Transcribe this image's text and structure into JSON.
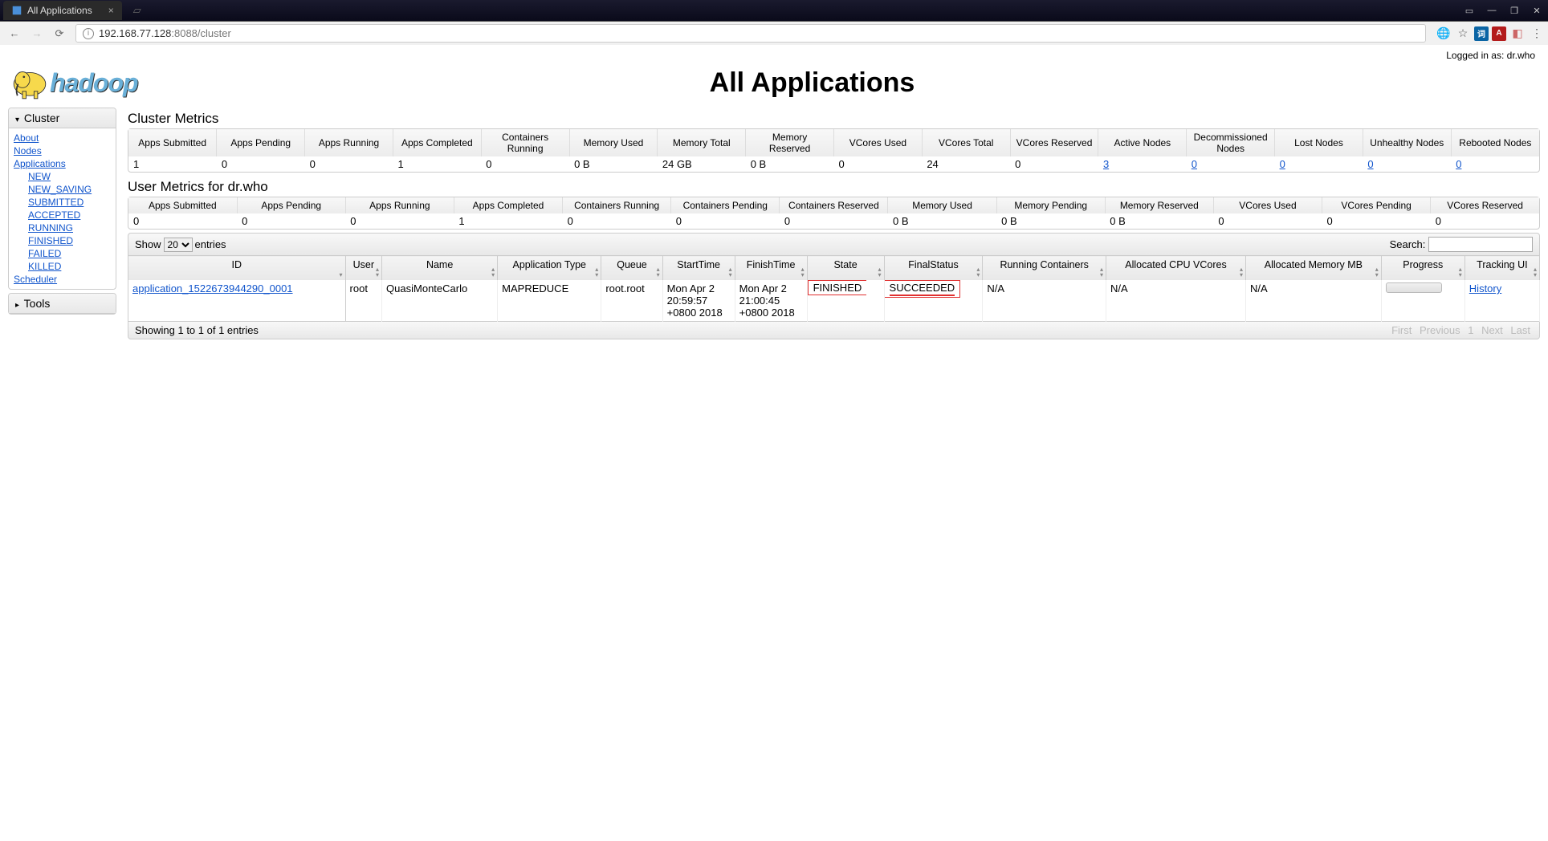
{
  "browser": {
    "tab_title": "All Applications",
    "url_host": "192.168.77.128",
    "url_rest": ":8088/cluster"
  },
  "logged_in": "Logged in as: dr.who",
  "page_title": "All Applications",
  "logo_text": "hadoop",
  "sidebar": {
    "cluster_head": "Cluster",
    "tools_head": "Tools",
    "links": {
      "about": "About",
      "nodes": "Nodes",
      "applications": "Applications",
      "new": "NEW",
      "new_saving": "NEW_SAVING",
      "submitted": "SUBMITTED",
      "accepted": "ACCEPTED",
      "running": "RUNNING",
      "finished": "FINISHED",
      "failed": "FAILED",
      "killed": "KILLED",
      "scheduler": "Scheduler"
    }
  },
  "cluster_metrics": {
    "title": "Cluster Metrics",
    "headers": [
      "Apps Submitted",
      "Apps Pending",
      "Apps Running",
      "Apps Completed",
      "Containers Running",
      "Memory Used",
      "Memory Total",
      "Memory Reserved",
      "VCores Used",
      "VCores Total",
      "VCores Reserved",
      "Active Nodes",
      "Decommissioned Nodes",
      "Lost Nodes",
      "Unhealthy Nodes",
      "Rebooted Nodes"
    ],
    "values": [
      "1",
      "0",
      "0",
      "1",
      "0",
      "0 B",
      "24 GB",
      "0 B",
      "0",
      "24",
      "0",
      "3",
      "0",
      "0",
      "0",
      "0"
    ]
  },
  "user_metrics": {
    "title": "User Metrics for dr.who",
    "headers": [
      "Apps Submitted",
      "Apps Pending",
      "Apps Running",
      "Apps Completed",
      "Containers Running",
      "Containers Pending",
      "Containers Reserved",
      "Memory Used",
      "Memory Pending",
      "Memory Reserved",
      "VCores Used",
      "VCores Pending",
      "VCores Reserved"
    ],
    "values": [
      "0",
      "0",
      "0",
      "1",
      "0",
      "0",
      "0",
      "0 B",
      "0 B",
      "0 B",
      "0",
      "0",
      "0"
    ]
  },
  "datatable": {
    "show_prefix": "Show",
    "show_value": "20",
    "show_suffix": "entries",
    "search_label": "Search:",
    "headers": [
      "ID",
      "User",
      "Name",
      "Application Type",
      "Queue",
      "StartTime",
      "FinishTime",
      "State",
      "FinalStatus",
      "Running Containers",
      "Allocated CPU VCores",
      "Allocated Memory MB",
      "Progress",
      "Tracking UI"
    ],
    "row": {
      "id": "application_1522673944290_0001",
      "user": "root",
      "name": "QuasiMonteCarlo",
      "type": "MAPREDUCE",
      "queue": "root.root",
      "start": "Mon Apr 2 20:59:57 +0800 2018",
      "finish": "Mon Apr 2 21:00:45 +0800 2018",
      "state": "FINISHED",
      "final": "SUCCEEDED",
      "running_containers": "N/A",
      "cpu": "N/A",
      "mem": "N/A",
      "tracking": "History"
    },
    "info": "Showing 1 to 1 of 1 entries",
    "pager": {
      "first": "First",
      "prev": "Previous",
      "p1": "1",
      "next": "Next",
      "last": "Last"
    }
  }
}
